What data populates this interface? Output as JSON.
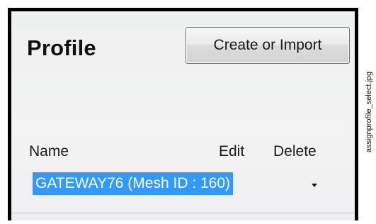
{
  "panel": {
    "title": "Profile",
    "create_button_label": "Create or Import"
  },
  "table": {
    "columns": [
      "Name",
      "Edit",
      "Delete"
    ],
    "selected_profile": "GATEWAY76 (Mesh ID : 160)"
  },
  "figure": {
    "filename": "assignprofile_select.jpg"
  }
}
